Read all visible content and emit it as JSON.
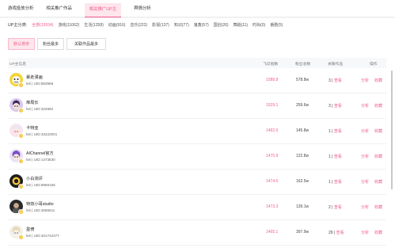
{
  "tabs": [
    {
      "label": "游戏投放分析"
    },
    {
      "label": "相关推广作品"
    },
    {
      "label": "相关推广UP主"
    },
    {
      "label": "舆情分析"
    }
  ],
  "filter": {
    "label": "UP主分类:",
    "items": [
      "全部(13534)",
      "游戏(11062)",
      "生活(1258)",
      "动画(916)",
      "音乐(222)",
      "影视(137)",
      "知识(77)",
      "鬼畜(57)",
      "国创(26)",
      "舞蹈(11)",
      "时尚(0)",
      "番剧(5)"
    ]
  },
  "sort_buttons": [
    "默认排序",
    "粉丝最多",
    "关联作品最多"
  ],
  "table": {
    "headers": {
      "up": "UP主信息",
      "volume": "飞瓜指数",
      "fans": "粉丝总数",
      "related": "关联作品",
      "ops": "操作"
    },
    "view_label": "查看",
    "analyze_label": "分析",
    "favorite_label": "收藏",
    "rows": [
      {
        "name": "暴走漫画",
        "level": "lv6",
        "uid": "UID:883968",
        "volume": "1588.8",
        "fans": "578.8w",
        "related": "3"
      },
      {
        "name": "痒局长",
        "level": "lv6",
        "uid": "UID:322892",
        "volume": "1529.1",
        "fans": "259.6w",
        "related": "3"
      },
      {
        "name": "卡特亚",
        "level": "lv6",
        "uid": "UID:43222001",
        "volume": "1492.6",
        "fans": "145.8w",
        "related": "1"
      },
      {
        "name": "AIChannel官方",
        "level": "lv6",
        "uid": "UID:1473830",
        "volume": "1475.9",
        "fans": "122.8w",
        "related": "1"
      },
      {
        "name": "小白测评",
        "level": "lv6",
        "uid": "UID:8969156",
        "volume": "1474.6",
        "fans": "162.5w",
        "related": "1"
      },
      {
        "name": "特效小哥studio",
        "level": "lv6",
        "uid": "UID:3066511",
        "volume": "1473.3",
        "fans": "139.1w",
        "related": "2"
      },
      {
        "name": "墨倚",
        "level": "lv6",
        "uid": "UID:401742377",
        "volume": "1465.1",
        "fans": "397.9w",
        "related": "29"
      }
    ]
  },
  "colors": {
    "accent": "#f25d8e"
  }
}
